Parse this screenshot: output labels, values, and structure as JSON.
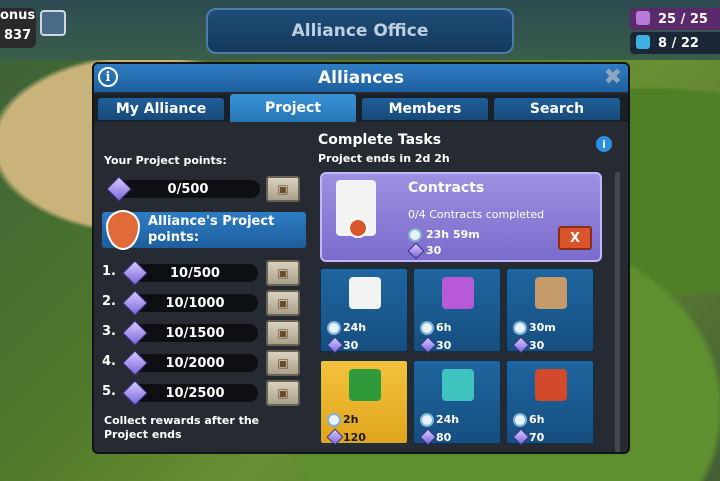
{
  "hud": {
    "bonus_label": "onus",
    "bonus_value": "837",
    "resource1": "25 / 25",
    "resource2": "8 / 22"
  },
  "office_title": "Alliance Office",
  "panel": {
    "title": "Alliances",
    "tabs": [
      "My Alliance",
      "Project",
      "Members",
      "Search"
    ],
    "active_tab": "Project"
  },
  "left": {
    "your_points_label": "Your Project points:",
    "your_points": "0/500",
    "alliance_label": "Alliance's Project points:",
    "alliance_points": [
      {
        "rank": "1.",
        "value": "10/500"
      },
      {
        "rank": "2.",
        "value": "10/1000"
      },
      {
        "rank": "3.",
        "value": "10/1500"
      },
      {
        "rank": "4.",
        "value": "10/2000"
      },
      {
        "rank": "5.",
        "value": "10/2500"
      }
    ],
    "footer": "Collect rewards after the Project ends"
  },
  "right": {
    "title": "Complete Tasks",
    "subtitle": "Project ends in 2d 2h",
    "contract": {
      "title": "Contracts",
      "progress": "0/4 Contracts completed",
      "time": "23h 59m",
      "points": "30",
      "cancel": "X"
    },
    "tasks": [
      {
        "icon": "contract-scroll-icon",
        "time": "24h",
        "points": "30"
      },
      {
        "icon": "cargo-transfer-icon",
        "time": "6h",
        "points": "30"
      },
      {
        "icon": "cardboard-box-icon",
        "time": "30m",
        "points": "30"
      },
      {
        "icon": "cash-stack-icon",
        "time": "2h",
        "points": "120",
        "highlight": true
      },
      {
        "icon": "anchor-icon",
        "time": "24h",
        "points": "80"
      },
      {
        "icon": "roof-tiles-icon",
        "time": "6h",
        "points": "70"
      }
    ]
  },
  "colors": {
    "panel_header": "#2f7dc4",
    "tab_active": "#3a93d6",
    "contract_card": "#9d8fe0",
    "task_tile": "#1f65a0",
    "task_highlight": "#f4c23c",
    "cancel_button": "#d8542a"
  }
}
